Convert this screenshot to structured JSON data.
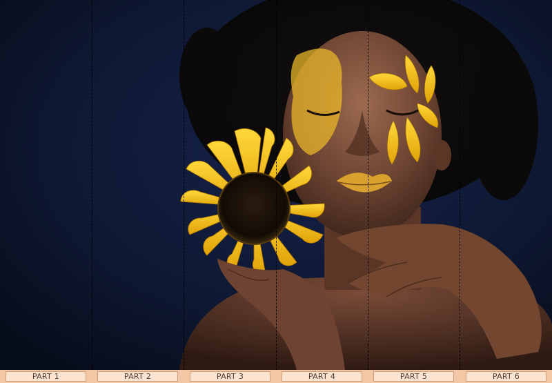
{
  "panels": {
    "labels": [
      "PART 1",
      "PART 2",
      "PART 3",
      "PART 4",
      "PART 5",
      "PART 6"
    ]
  },
  "colors": {
    "background": "#0e1832",
    "accent_yellow": "#f2c114",
    "label_bar": "#f2c7a6",
    "label_fill": "#fbe3cf",
    "label_border": "#d49c76"
  }
}
